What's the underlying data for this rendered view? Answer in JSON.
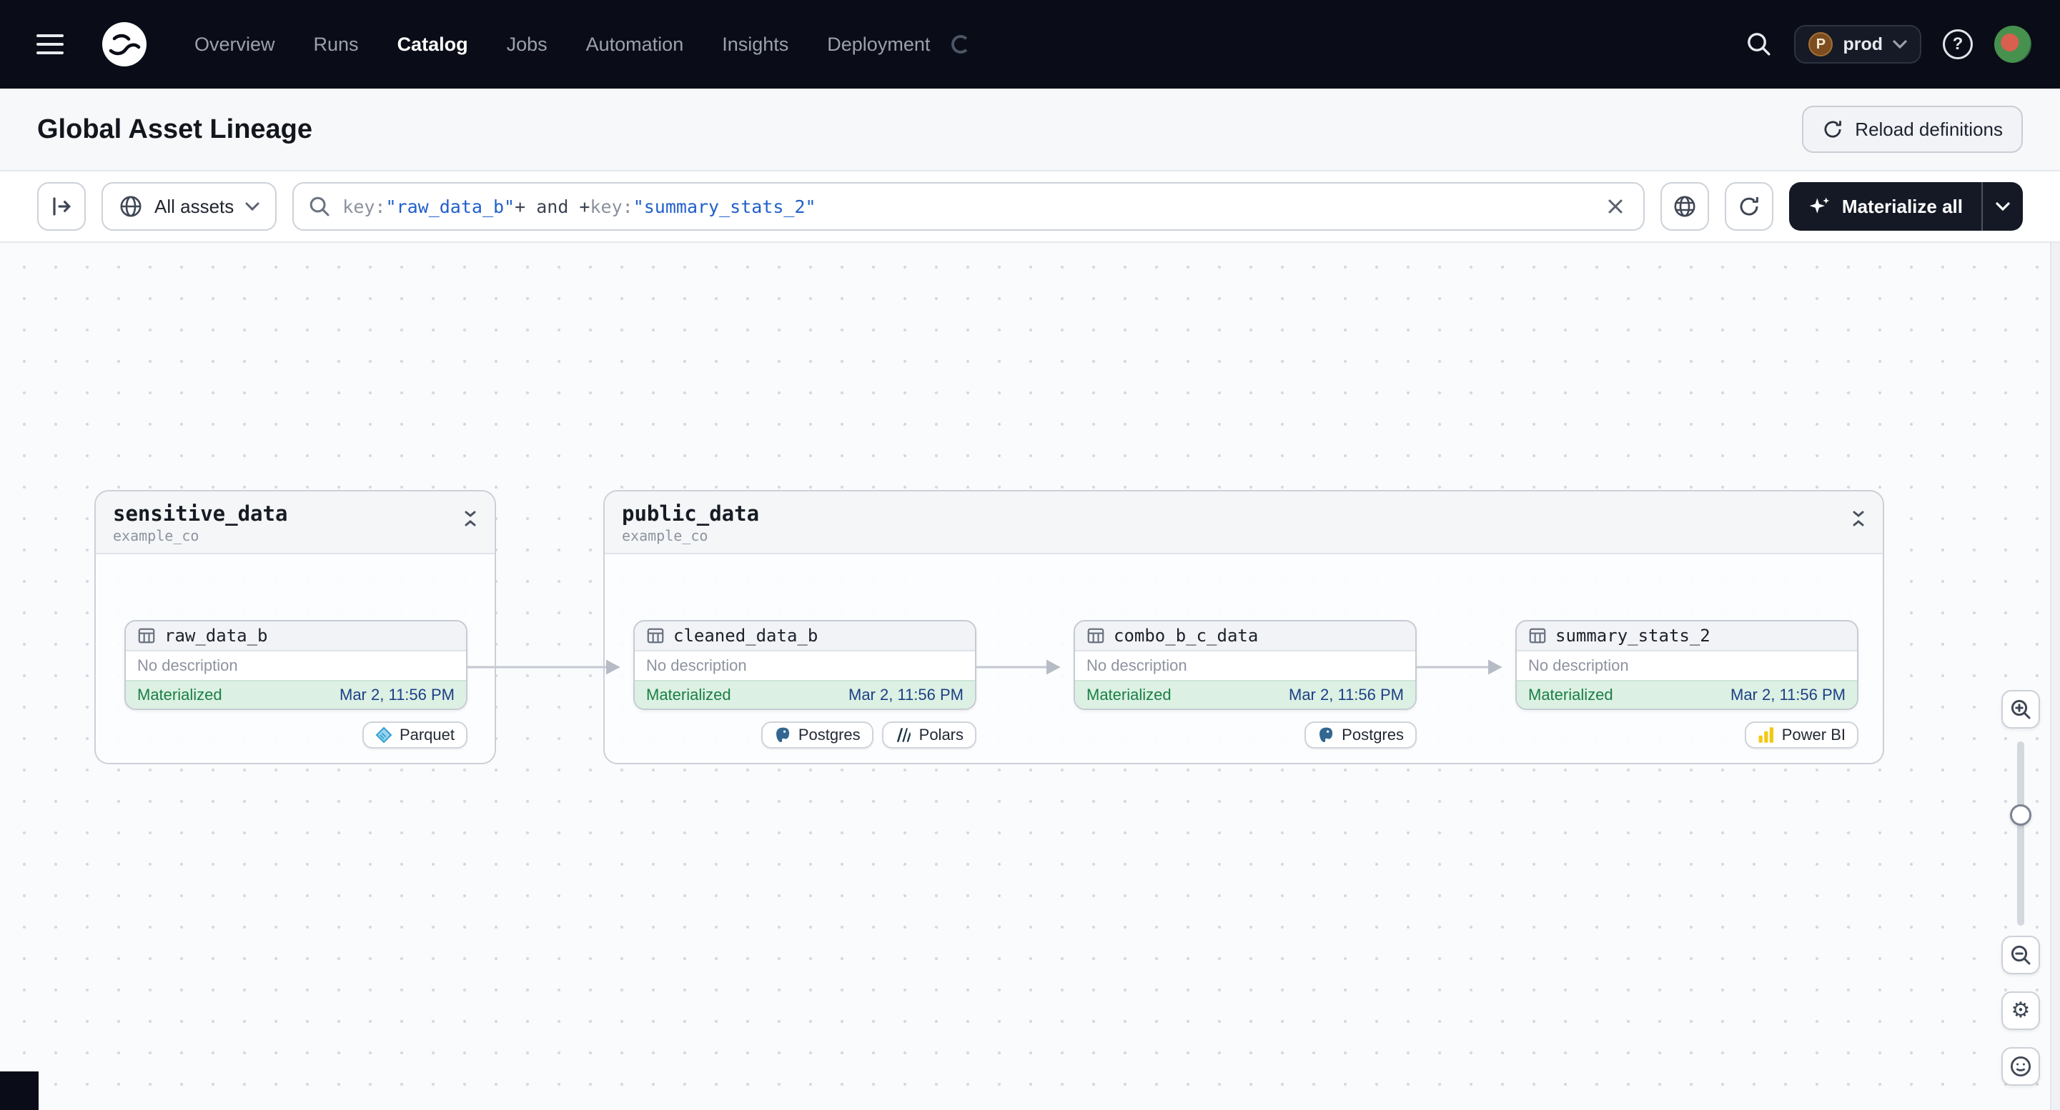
{
  "nav": {
    "items": [
      "Overview",
      "Runs",
      "Catalog",
      "Jobs",
      "Automation",
      "Insights",
      "Deployment"
    ],
    "active_item": "Catalog",
    "environment": {
      "initial": "P",
      "name": "prod"
    }
  },
  "header": {
    "title": "Global Asset Lineage",
    "reload_button": "Reload definitions"
  },
  "toolbar": {
    "scope_button": "All assets",
    "query": {
      "token_key_1": "key:",
      "token_value_1": "\"raw_data_b\"",
      "token_op": "+ and +",
      "token_key_2": "key:",
      "token_value_2": "\"summary_stats_2\""
    },
    "materialize_button": "Materialize all"
  },
  "graph": {
    "groups": [
      {
        "name": "sensitive_data",
        "subtitle": "example_co"
      },
      {
        "name": "public_data",
        "subtitle": "example_co"
      }
    ],
    "assets": [
      {
        "name": "raw_data_b",
        "group": "sensitive_data",
        "description": "No description",
        "status": "Materialized",
        "materialized_at": "Mar 2, 11:56 PM",
        "badges": [
          "Parquet"
        ]
      },
      {
        "name": "cleaned_data_b",
        "group": "public_data",
        "description": "No description",
        "status": "Materialized",
        "materialized_at": "Mar 2, 11:56 PM",
        "badges": [
          "Postgres",
          "Polars"
        ]
      },
      {
        "name": "combo_b_c_data",
        "group": "public_data",
        "description": "No description",
        "status": "Materialized",
        "materialized_at": "Mar 2, 11:56 PM",
        "badges": [
          "Postgres"
        ]
      },
      {
        "name": "summary_stats_2",
        "group": "public_data",
        "description": "No description",
        "status": "Materialized",
        "materialized_at": "Mar 2, 11:56 PM",
        "badges": [
          "Power BI"
        ]
      }
    ],
    "edges": [
      {
        "from": "raw_data_b",
        "to": "cleaned_data_b"
      },
      {
        "from": "cleaned_data_b",
        "to": "combo_b_c_data"
      },
      {
        "from": "combo_b_c_data",
        "to": "summary_stats_2"
      }
    ]
  },
  "icons": {
    "help_glyph": "?",
    "gear_glyph": "⚙"
  },
  "colors": {
    "nav_bg": "#0a0d17",
    "accent_blue": "#2160c9",
    "status_green": "#1a7f45",
    "status_bg": "#dcf0e3",
    "edge_gray": "#c3c8d1"
  }
}
